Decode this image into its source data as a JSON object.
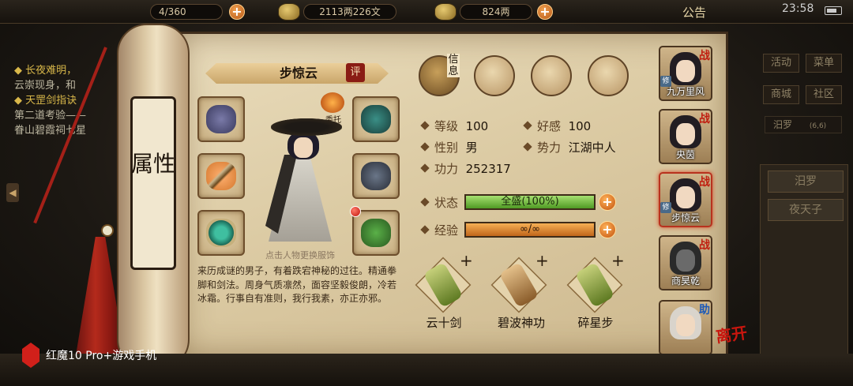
{
  "topbar": {
    "resource1": "4/360",
    "money": "2113两226文",
    "gold": "824两",
    "notice": "公告",
    "clock": "23:58"
  },
  "left_panel": {
    "line1": "◆ 长夜难明，",
    "line2": "云崇现身，和",
    "line3": "◆ 天罡剑指诀",
    "line4": "第二道考验——",
    "line5": "眷山碧霞祠七星"
  },
  "scroll_title": "属性",
  "character": {
    "name": "步惊云",
    "eval_button": "评",
    "delegate_label": "委托",
    "hint": "点击人物更换服饰",
    "description": "来历成谜的男子，有着跌宕神秘的过往。精通拳脚和剑法。周身气质凛然，面容坚毅俊朗，冷若冰霜。行事自有准则，我行我素，亦正亦邪。"
  },
  "info_tabs": {
    "letter_label": "信息",
    "tab_icons": [
      "hat-icon",
      "scroll-book-icon",
      "bagua-icon",
      "meridian-body-icon"
    ]
  },
  "stats": {
    "level_label": "等级",
    "level": "100",
    "favor_label": "好感",
    "favor": "100",
    "gender_label": "性别",
    "gender": "男",
    "faction_label": "势力",
    "faction": "江湖中人",
    "power_label": "功力",
    "power": "252317"
  },
  "bars": {
    "status_label": "状态",
    "status_text": "全盛(100%)",
    "status_fill": 1.0,
    "exp_label": "经验",
    "exp_text": "∞/∞",
    "exp_fill": 1.0
  },
  "skills": [
    {
      "name": "云十剑"
    },
    {
      "name": "碧波神功"
    },
    {
      "name": "碎星步"
    }
  ],
  "skill_plus": "+",
  "roster": [
    {
      "name": "九万里风",
      "tag": "战",
      "badge": "修"
    },
    {
      "name": "央茵",
      "tag": "战",
      "badge": ""
    },
    {
      "name": "步惊云",
      "tag": "战",
      "badge": "修"
    },
    {
      "name": "商昊乾",
      "tag": "战",
      "badge": ""
    },
    {
      "name": "",
      "tag": "助",
      "badge": ""
    }
  ],
  "leave_label": "离开",
  "right_menu": {
    "activity": "活动",
    "menu": "菜单",
    "shop": "商城",
    "community": "社区",
    "location": "汨罗",
    "location_coord": "(6,6)",
    "tab1": "汨罗",
    "tab2": "夜天子"
  },
  "watermark": "红魔10 Pro+游戏手机",
  "colors": {
    "parchment": "#dccba4",
    "status_bar": "#6fb13a",
    "exp_bar": "#e08a2a",
    "accent_red": "#c01e10"
  }
}
